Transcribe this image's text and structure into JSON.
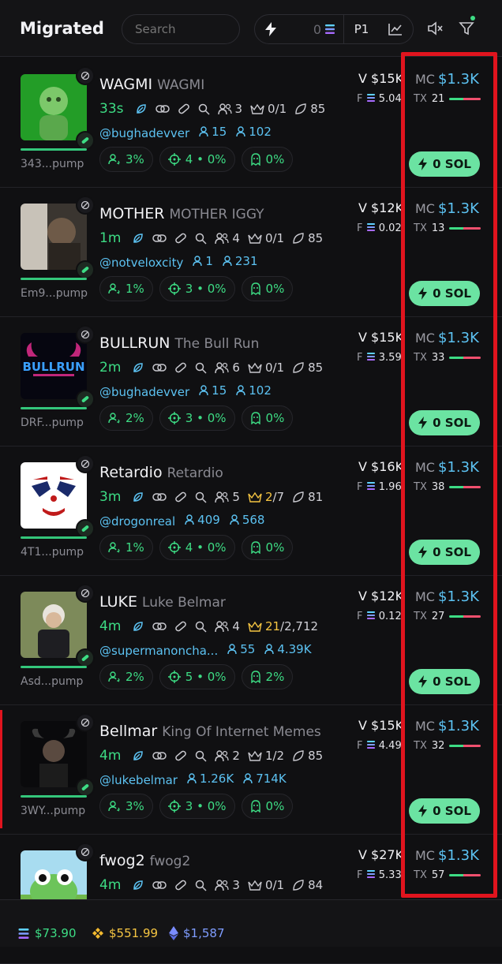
{
  "header": {
    "title": "Migrated",
    "search_placeholder": "Search",
    "quick_buy_amount": "0",
    "preset": "P1"
  },
  "tokens": [
    {
      "ticker": "WAGMI",
      "name": "WAGMI",
      "age": "33s",
      "holders": "3",
      "top10": "0",
      "top10_total": "/1",
      "pro_traders": "85",
      "address": "343...pump",
      "handle": "@bughadevver",
      "followers": "15",
      "following": "102",
      "pill_holders": "3%",
      "pill_snipers": "4 • 0%",
      "pill_insiders": "0%",
      "volume": "V $15K",
      "fees": "5.04",
      "market_cap": "$1.3K",
      "tx": "21",
      "buy": "0 SOL",
      "top10_gold": false
    },
    {
      "ticker": "MOTHER",
      "name": "MOTHER IGGY",
      "age": "1m",
      "holders": "4",
      "top10": "0",
      "top10_total": "/1",
      "pro_traders": "85",
      "address": "Em9...pump",
      "handle": "@notveloxcity",
      "followers": "1",
      "following": "231",
      "pill_holders": "1%",
      "pill_snipers": "3 • 0%",
      "pill_insiders": "0%",
      "volume": "V $12K",
      "fees": "0.02",
      "market_cap": "$1.3K",
      "tx": "13",
      "buy": "0 SOL",
      "top10_gold": false
    },
    {
      "ticker": "BULLRUN",
      "name": "The Bull Run",
      "age": "2m",
      "holders": "6",
      "top10": "0",
      "top10_total": "/1",
      "pro_traders": "85",
      "address": "DRF...pump",
      "handle": "@bughadevver",
      "followers": "15",
      "following": "102",
      "pill_holders": "2%",
      "pill_snipers": "3 • 0%",
      "pill_insiders": "0%",
      "volume": "V $15K",
      "fees": "3.59",
      "market_cap": "$1.3K",
      "tx": "33",
      "buy": "0 SOL",
      "top10_gold": false
    },
    {
      "ticker": "Retardio",
      "name": "Retardio",
      "age": "3m",
      "holders": "5",
      "top10": "2",
      "top10_total": "/7",
      "pro_traders": "81",
      "address": "4T1...pump",
      "handle": "@drogonreal",
      "followers": "409",
      "following": "568",
      "pill_holders": "1%",
      "pill_snipers": "4 • 0%",
      "pill_insiders": "0%",
      "volume": "V $16K",
      "fees": "1.96",
      "market_cap": "$1.3K",
      "tx": "38",
      "buy": "0 SOL",
      "top10_gold": true
    },
    {
      "ticker": "LUKE",
      "name": "Luke Belmar",
      "age": "4m",
      "holders": "4",
      "top10": "21",
      "top10_total": "/2,712",
      "pro_traders": "",
      "address": "Asd...pump",
      "handle": "@supermanoncha...",
      "followers": "55",
      "following": "4.39K",
      "pill_holders": "2%",
      "pill_snipers": "5 • 0%",
      "pill_insiders": "2%",
      "volume": "V $12K",
      "fees": "0.123",
      "market_cap": "$1.3K",
      "tx": "27",
      "buy": "0 SOL",
      "top10_gold": true
    },
    {
      "ticker": "Bellmar",
      "name": "King Of Internet Memes",
      "age": "4m",
      "holders": "2",
      "top10": "1",
      "top10_total": "/2",
      "pro_traders": "85",
      "address": "3WY...pump",
      "handle": "@lukebelmar",
      "followers": "1.26K",
      "following": "714K",
      "pill_holders": "3%",
      "pill_snipers": "3 • 0%",
      "pill_insiders": "0%",
      "volume": "V $15K",
      "fees": "4.49",
      "market_cap": "$1.3K",
      "tx": "32",
      "buy": "0 SOL",
      "top10_gold": false
    },
    {
      "ticker": "fwog2",
      "name": "fwog2",
      "age": "4m",
      "holders": "3",
      "top10": "0",
      "top10_total": "/1",
      "pro_traders": "84",
      "address": "",
      "handle": "",
      "followers": "",
      "following": "",
      "pill_holders": "",
      "pill_snipers": "",
      "pill_insiders": "",
      "volume": "V $27K",
      "fees": "5.33",
      "market_cap": "$1.3K",
      "tx": "57",
      "buy": "",
      "top10_gold": false
    }
  ],
  "footer": {
    "sol_price": "$73.90",
    "bnb_price": "$551.99",
    "eth_price": "$1,587"
  },
  "colors": {
    "accent_green": "#3ddc84",
    "link_blue": "#5cc2f2",
    "highlight_red": "#e0141e",
    "buy_button": "#6be3a2"
  }
}
